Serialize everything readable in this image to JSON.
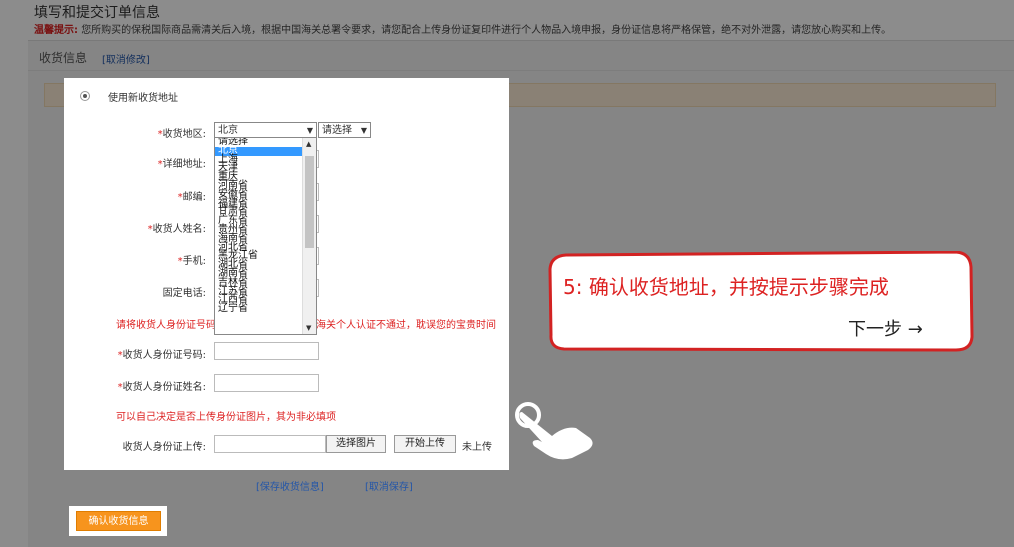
{
  "header": {
    "title": "填写和提交订单信息",
    "notice_label": "温馨提示:",
    "notice_text": "您所购买的保税国际商品需清关后入境，根据中国海关总署令要求，请您配合上传身份证复印件进行个人物品入境申报，身份证信息将严格保管，绝不对外泄露，请您放心购买和上传。"
  },
  "section": {
    "title": "收货信息",
    "cancel_edit": "[取消修改]"
  },
  "form": {
    "use_new_address": "使用新收货地址",
    "region_label": "收货地区:",
    "province_value": "北京",
    "city_value": "请选择",
    "address_label": "详细地址:",
    "zip_label": "邮编:",
    "name_label": "收货人姓名:",
    "mobile_label": "手机:",
    "phone_label": "固定电话:",
    "id_note_left": "请将收货人身份证号码",
    "id_note_right": "海关个人认证不通过，耽误您的宝贵时间",
    "id_number_label": "收货人身份证号码:",
    "id_name_label": "收货人身份证姓名:",
    "optional_note": "可以自己决定是否上传身份证图片，其为非必填项",
    "upload_label": "收货人身份证上传:",
    "choose_button": "选择图片",
    "start_upload_button": "开始上传",
    "upload_status": "未上传",
    "required_mark": "*"
  },
  "province_options": [
    "请选择",
    "北京",
    "上海",
    "天津",
    "重庆",
    "河南省",
    "安徽省",
    "福建省",
    "甘肃省",
    "广东省",
    "贵州省",
    "海南省",
    "河北省",
    "黑龙江省",
    "湖北省",
    "湖南省",
    "吉林省",
    "江苏省",
    "江西省",
    "辽宁省"
  ],
  "actions": {
    "save_address": "[保存收货信息]",
    "cancel_save": "[取消保存]",
    "confirm": "确认收货信息"
  },
  "callout": {
    "text": "5: 确认收货地址，并按提示步骤完成",
    "next": "下一步 →",
    "accent_color": "#d22222"
  }
}
